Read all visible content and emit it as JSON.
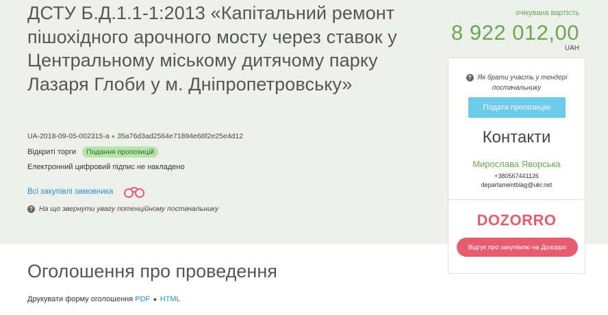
{
  "tender": {
    "title": "ДСТУ Б.Д.1.1-1:2013 «Капітальний ремонт пішохідного арочного мосту через ставок у Центральному міському дитячому парку Лазаря Глоби у м. Дніпропетровську»",
    "id": "UA-2018-09-05-002315-a",
    "hash": "35a76d3ad2564e71894e68f2e25e4d12",
    "procedure_type": "Відкриті торги",
    "status": "Подання пропозицій",
    "signature_note": "Електронний цифровий підпис не накладено",
    "all_purchases_link": "Всі закупівлі замовника",
    "attention_note": "На що звернути увагу потенційному постачальнику"
  },
  "cost": {
    "label": "очікувана вартість",
    "value": "8 922 012,00",
    "currency": "UAH"
  },
  "sidebar": {
    "how_to_participate": "Як брати участь у тендері постачальнику",
    "submit_button": "Подати пропозицію",
    "contacts_title": "Контакти",
    "contact_name": "Мирослава Яворська",
    "contact_phone": "+380567441126",
    "contact_email": "departamentblag@ukr.net",
    "dozorro_logo": "DOZORRO",
    "dozorro_button": "Відгук про закупівлю на Дозорро"
  },
  "announcement": {
    "title": "Оголошення про проведення",
    "print_label": "Друкувати форму оголошення",
    "pdf_link": "PDF",
    "html_link": "HTML"
  },
  "icons": {
    "question": "question-circle-icon",
    "binoculars": "binoculars-icon"
  },
  "colors": {
    "accent_green": "#6aa84f",
    "link_blue": "#2e8fcf",
    "button_blue": "#6ccbe8",
    "dozorro_red": "#e85c6f"
  }
}
